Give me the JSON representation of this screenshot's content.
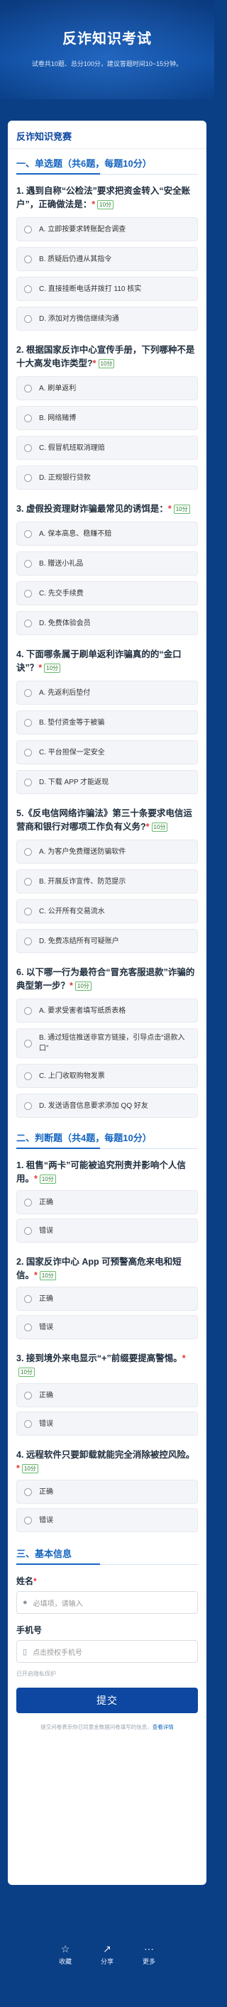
{
  "header": {
    "title": "反诈知识考试",
    "subtitle": "试卷共10题、总分100分，建议答题时间10~15分钟。"
  },
  "form": {
    "title": "反诈知识竞赛",
    "sections": {
      "single": "一、单选题（共6题，每题10分）",
      "judge": "二、判断题（共4题，每题10分）",
      "info": "三、基本信息"
    },
    "score_badge": "10分",
    "required_mark": "*",
    "single_questions": [
      {
        "title": "1. 遇到自称“公检法”要求把资金转入“安全账户”，正确做法是：",
        "options": [
          "A. 立即按要求转账配合调查",
          "B. 质疑后仍遵从其指令",
          "C. 直接挂断电话并拨打 110 核实",
          "D. 添加对方微信继续沟通"
        ]
      },
      {
        "title": "2. 根据国家反诈中心宣传手册，下列哪种不是十大高发电诈类型?",
        "options": [
          "A. 刷单返利",
          "B. 网络赌博",
          "C. 假冒机班取消理赔",
          "D. 正规银行贷款"
        ]
      },
      {
        "title": "3. 虚假投资理财诈骗最常见的诱饵是：",
        "options": [
          "A. 保本高息、稳赚不赔",
          "B. 赠送小礼品",
          "C. 先交手续费",
          "D. 免费体验会员"
        ]
      },
      {
        "title": "4. 下面哪条属于刷单返利诈骗真的的“金口诀”？",
        "options": [
          "A. 先返利后垫付",
          "B. 垫付资金等于被骗",
          "C. 平台担保一定安全",
          "D. 下载 APP 才能返现"
        ]
      },
      {
        "title": "5.《反电信网络诈骗法》第三十条要求电信运营商和银行对哪项工作负有义务?",
        "options": [
          "A. 为客户免费赠送防骗软件",
          "B. 开展反诈宣传、防范提示",
          "C. 公开所有交易流水",
          "D. 免费冻结所有可疑账户"
        ]
      },
      {
        "title": "6. 以下哪一行为最符合“冒充客服退款”诈骗的典型第一步？",
        "options": [
          "A. 要求受害者填写纸质表格",
          "B. 通过短信推送非官方链接，引导点击“退款入口”",
          "C. 上门收取购物发票",
          "D. 发送语音信息要求添加 QQ 好友"
        ]
      }
    ],
    "judge_questions": [
      {
        "title": "1. 租售“两卡”可能被追究刑责并影响个人信用。",
        "options": [
          "正确",
          "错误"
        ]
      },
      {
        "title": "2. 国家反诈中心 App 可预警高危来电和短信。",
        "options": [
          "正确",
          "错误"
        ]
      },
      {
        "title": "3. 接到境外来电显示“+”前缀要提高警惕。",
        "options": [
          "正确",
          "错误"
        ]
      },
      {
        "title": "4. 远程软件只要卸载就能完全消除被控风险。",
        "options": [
          "正确",
          "错误"
        ]
      }
    ],
    "name_field": {
      "label": "姓名",
      "placeholder": "必填项，请输入"
    },
    "phone_field": {
      "label": "手机号",
      "placeholder": "点击授权手机号"
    },
    "privacy_note": "已开启隐私保护",
    "submit_label": "提交",
    "footer_note": "提交问卷表示你已同意金数据问卷填写的信息，",
    "footer_link": "查看详情"
  },
  "bottom_nav": [
    {
      "label": "收藏",
      "icon": "star-icon"
    },
    {
      "label": "分享",
      "icon": "share-icon"
    },
    {
      "label": "更多",
      "icon": "more-icon"
    }
  ]
}
